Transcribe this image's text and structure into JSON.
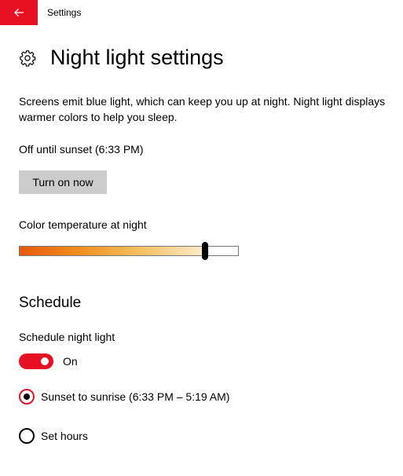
{
  "window": {
    "app_title": "Settings",
    "accent_color": "#e81123"
  },
  "page": {
    "title": "Night light settings",
    "icon": "gear-icon",
    "description": "Screens emit blue light, which can keep you up at night. Night light displays warmer colors to help you sleep.",
    "status": "Off until sunset (6:33 PM)",
    "turn_on_label": "Turn on now"
  },
  "color_temperature": {
    "label": "Color temperature at night",
    "level": 0.85
  },
  "schedule": {
    "heading": "Schedule",
    "toggle_label": "Schedule night light",
    "toggle_state": "On",
    "toggle_on": true,
    "options": [
      {
        "label": "Sunset to sunrise (6:33 PM – 5:19 AM)",
        "selected": true
      },
      {
        "label": "Set hours",
        "selected": false
      }
    ]
  }
}
